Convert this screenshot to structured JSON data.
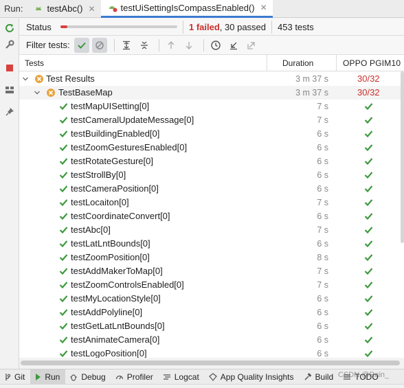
{
  "runbar": {
    "label": "Run:",
    "tabs": [
      {
        "label": "testAbc()",
        "active": false
      },
      {
        "label": "testUiSettingIsCompassEnabled()",
        "active": true
      }
    ]
  },
  "status": {
    "label": "Status",
    "progress_fraction": 0.06,
    "failed_text": "1 failed",
    "passed_text": ", 30 passed",
    "tests_text": "453 tests"
  },
  "filter": {
    "label": "Filter tests:"
  },
  "table": {
    "headers": {
      "tests": "Tests",
      "duration": "Duration",
      "device": "OPPO  PGIM10"
    },
    "root": {
      "name": "Test Results",
      "duration": "3 m 37 s",
      "result": "30/32"
    },
    "suite": {
      "name": "TestBaseMap",
      "duration": "3 m 37 s",
      "result": "30/32"
    },
    "tests": [
      {
        "name": "testMapUISetting[0]",
        "duration": "7 s"
      },
      {
        "name": "testCameralUpdateMessage[0]",
        "duration": "7 s"
      },
      {
        "name": "testBuildingEnabled[0]",
        "duration": "6 s"
      },
      {
        "name": "testZoomGesturesEnabled[0]",
        "duration": "6 s"
      },
      {
        "name": "testRotateGesture[0]",
        "duration": "6 s"
      },
      {
        "name": "testStrollBy[0]",
        "duration": "6 s"
      },
      {
        "name": "testCameraPosition[0]",
        "duration": "6 s"
      },
      {
        "name": "testLocaiton[0]",
        "duration": "7 s"
      },
      {
        "name": "testCoordinateConvert[0]",
        "duration": "6 s"
      },
      {
        "name": "testAbc[0]",
        "duration": "7 s"
      },
      {
        "name": "testLatLntBounds[0]",
        "duration": "6 s"
      },
      {
        "name": "testZoomPosition[0]",
        "duration": "8 s"
      },
      {
        "name": "testAddMakerToMap[0]",
        "duration": "7 s"
      },
      {
        "name": "testZoomControlsEnabled[0]",
        "duration": "7 s"
      },
      {
        "name": "testMyLocationStyle[0]",
        "duration": "6 s"
      },
      {
        "name": "testAddPolyline[0]",
        "duration": "6 s"
      },
      {
        "name": "testGetLatLntBounds[0]",
        "duration": "6 s"
      },
      {
        "name": "testAnimateCamera[0]",
        "duration": "6 s"
      },
      {
        "name": "testLogoPosition[0]",
        "duration": "6 s"
      }
    ]
  },
  "bottombar": {
    "items": [
      {
        "label": "Git",
        "icon": "git-branch-icon"
      },
      {
        "label": "Run",
        "icon": "run-icon"
      },
      {
        "label": "Debug",
        "icon": "bug-icon"
      },
      {
        "label": "Profiler",
        "icon": "gauge-icon"
      },
      {
        "label": "Logcat",
        "icon": "logcat-icon"
      },
      {
        "label": "App Quality Insights",
        "icon": "diamond-icon"
      },
      {
        "label": "Build",
        "icon": "hammer-icon"
      },
      {
        "label": "TODO",
        "icon": "list-icon"
      }
    ]
  },
  "watermark": "CSDN @Rain_",
  "colors": {
    "pass": "#3d9a3d",
    "fail": "#c9302c",
    "warning": "#e8a33d",
    "accent": "#3c7ad1"
  }
}
